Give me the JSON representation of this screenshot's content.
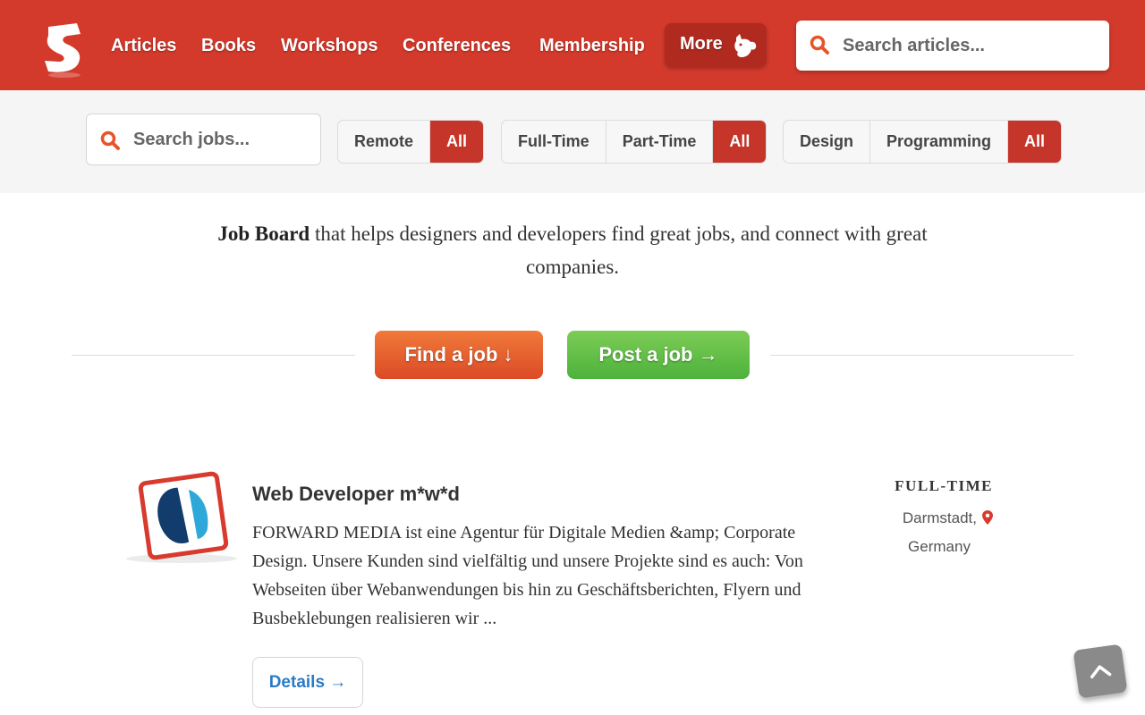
{
  "header": {
    "nav": [
      "Articles",
      "Books",
      "Workshops",
      "Conferences",
      "Membership"
    ],
    "more_label": "More",
    "search_placeholder": "Search articles..."
  },
  "filters": {
    "search_placeholder": "Search jobs...",
    "remote": [
      {
        "label": "Remote",
        "active": false
      },
      {
        "label": "All",
        "active": true
      }
    ],
    "type": [
      {
        "label": "Full-Time",
        "active": false
      },
      {
        "label": "Part-Time",
        "active": false
      },
      {
        "label": "All",
        "active": true
      }
    ],
    "category": [
      {
        "label": "Design",
        "active": false
      },
      {
        "label": "Programming",
        "active": false
      },
      {
        "label": "All",
        "active": true
      }
    ]
  },
  "intro": {
    "bold": "Job Board",
    "text": " that helps designers and developers find great jobs, and connect with great companies."
  },
  "cta": {
    "find": "Find a job ↓",
    "post": "Post a job →"
  },
  "job": {
    "title": "Web Developer m*w*d",
    "description": "FORWARD MEDIA ist eine Agentur für Digitale Medien &amp; Corporate Design. Unsere Kunden sind vielfältig und unsere Projekte sind es auch: Von Webseiten über Webanwendungen bis hin zu Geschäftsberichten, Flyern und Busbeklebungen realisieren wir ...",
    "type": "FULL-TIME",
    "city": "Darmstadt,",
    "country": "Germany",
    "details_label": "Details →"
  },
  "colors": {
    "brand": "#d33a2c",
    "active_filter": "#c5352a",
    "find_button": "#e55a2e",
    "post_button": "#5dbb45",
    "link": "#2a7bc4"
  }
}
